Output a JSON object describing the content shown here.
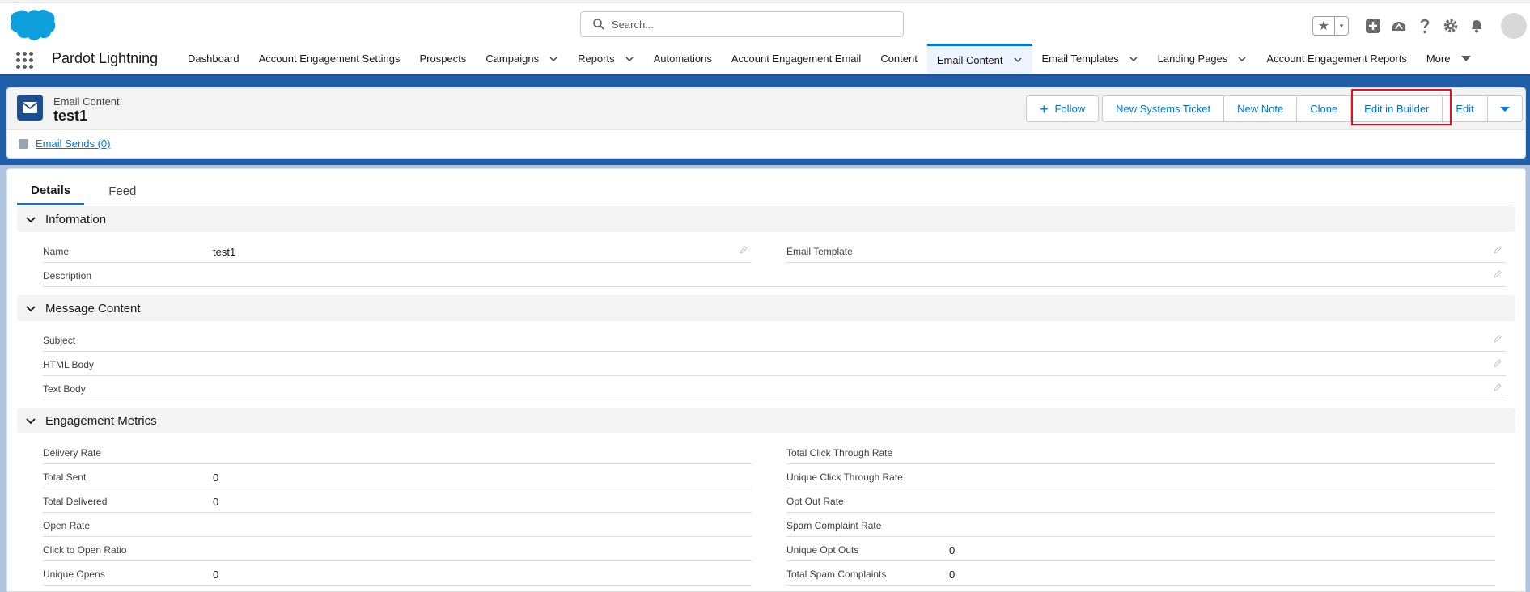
{
  "search": {
    "placeholder": "Search..."
  },
  "global_actions": {
    "star": "★",
    "caret": "▾"
  },
  "nav": {
    "app_name": "Pardot Lightning",
    "items": [
      {
        "label": "Dashboard",
        "has_menu": false
      },
      {
        "label": "Account Engagement Settings",
        "has_menu": false
      },
      {
        "label": "Prospects",
        "has_menu": false
      },
      {
        "label": "Campaigns",
        "has_menu": true
      },
      {
        "label": "Reports",
        "has_menu": true
      },
      {
        "label": "Automations",
        "has_menu": false
      },
      {
        "label": "Account Engagement Email",
        "has_menu": false
      },
      {
        "label": "Content",
        "has_menu": false
      },
      {
        "label": "Email Content",
        "has_menu": true,
        "active": true
      },
      {
        "label": "Email Templates",
        "has_menu": true
      },
      {
        "label": "Landing Pages",
        "has_menu": true
      },
      {
        "label": "Account Engagement Reports",
        "has_menu": false
      }
    ],
    "more_label": "More"
  },
  "record": {
    "object_type": "Email Content",
    "name": "test1",
    "actions": {
      "follow": "Follow",
      "new_systems_ticket": "New Systems Ticket",
      "new_note": "New Note",
      "clone": "Clone",
      "edit_in_builder": "Edit in Builder",
      "edit": "Edit"
    },
    "related_link": "Email Sends (0)"
  },
  "tabs": {
    "details": "Details",
    "feed": "Feed"
  },
  "sections": {
    "information": {
      "title": "Information",
      "fields": {
        "name_label": "Name",
        "name_value": "test1",
        "description_label": "Description",
        "email_template_label": "Email Template"
      }
    },
    "message_content": {
      "title": "Message Content",
      "fields": {
        "subject": "Subject",
        "html_body": "HTML Body",
        "text_body": "Text Body"
      }
    },
    "engagement_metrics": {
      "title": "Engagement Metrics",
      "left": [
        {
          "label": "Delivery Rate",
          "value": ""
        },
        {
          "label": "Total Sent",
          "value": "0"
        },
        {
          "label": "Total Delivered",
          "value": "0"
        },
        {
          "label": "Open Rate",
          "value": ""
        },
        {
          "label": "Click to Open Ratio",
          "value": ""
        },
        {
          "label": "Unique Opens",
          "value": "0"
        }
      ],
      "right": [
        {
          "label": "Total Click Through Rate",
          "value": ""
        },
        {
          "label": "Unique Click Through Rate",
          "value": ""
        },
        {
          "label": "Opt Out Rate",
          "value": ""
        },
        {
          "label": "Spam Complaint Rate",
          "value": ""
        },
        {
          "label": "Unique Opt Outs",
          "value": "0"
        },
        {
          "label": "Total Spam Complaints",
          "value": "0"
        }
      ]
    }
  },
  "colors": {
    "brand_blue": "#0176d3",
    "nav_bar": "#1b5297",
    "highlight_red": "#e0141e"
  }
}
